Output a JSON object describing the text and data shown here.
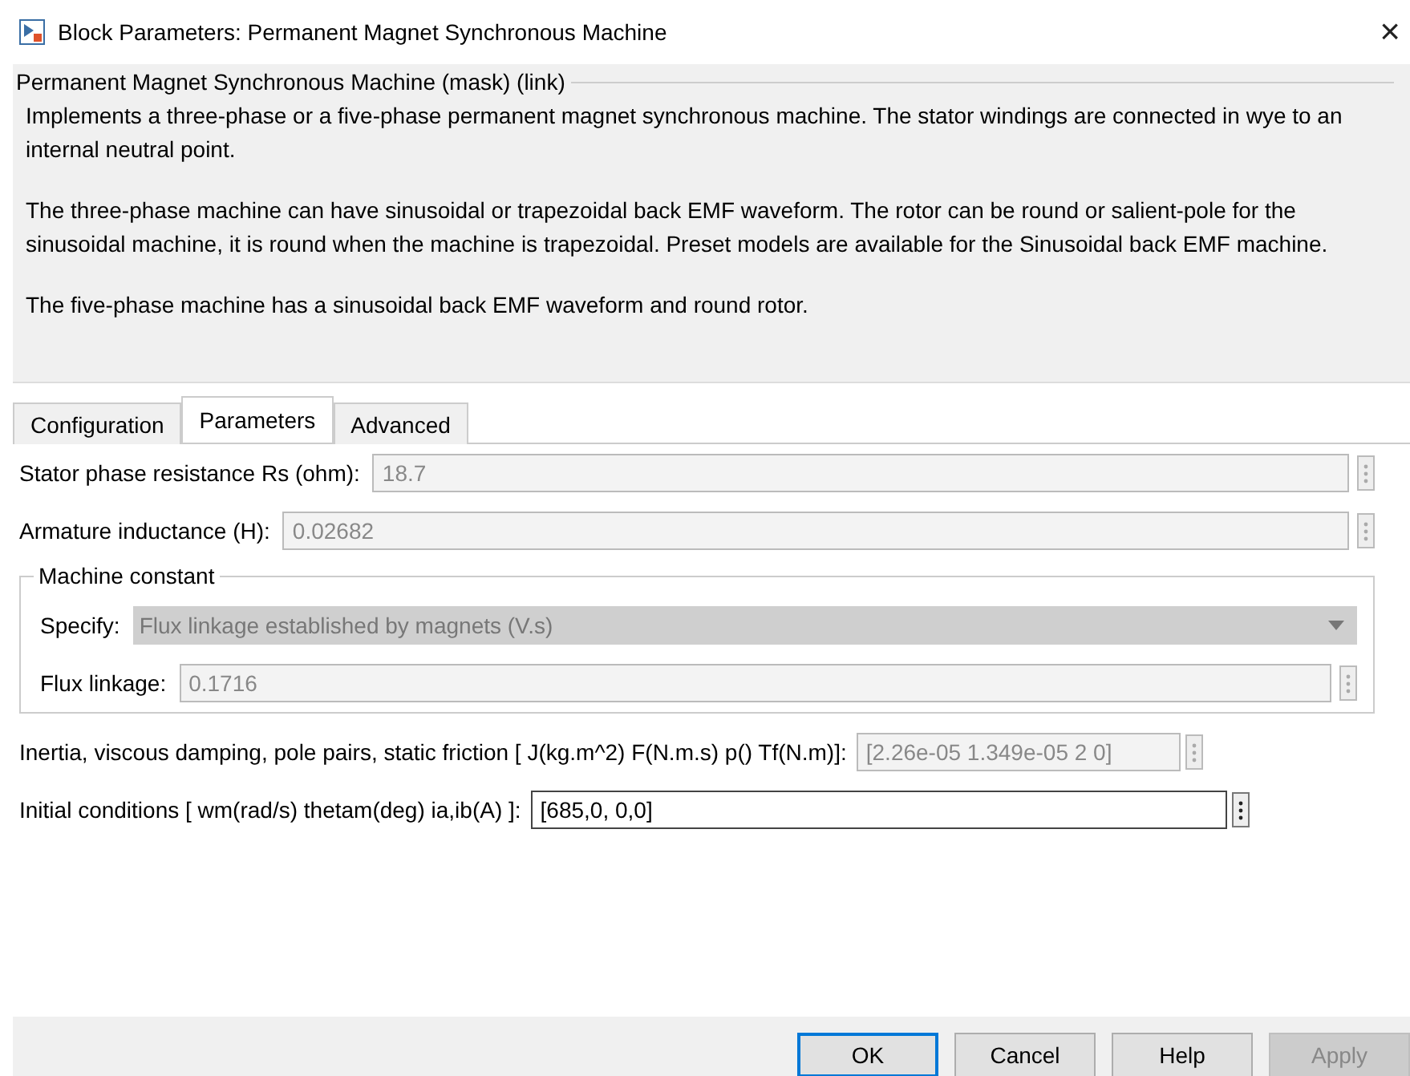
{
  "window": {
    "title": "Block Parameters: Permanent Magnet Synchronous Machine",
    "close": "×"
  },
  "description": {
    "title": "Permanent Magnet Synchronous Machine (mask) (link)",
    "paragraphs": [
      "Implements a three-phase or a five-phase permanent magnet synchronous machine. The stator windings are connected in wye to an internal neutral point.",
      "The three-phase machine can have sinusoidal or trapezoidal back EMF waveform. The rotor can be round or salient-pole for the sinusoidal machine, it is round when the machine is trapezoidal. Preset models are available for the Sinusoidal back EMF machine.",
      "The five-phase machine has a sinusoidal back EMF waveform and round rotor."
    ]
  },
  "tabs": [
    {
      "label": "Configuration",
      "selected": false
    },
    {
      "label": "Parameters",
      "selected": true
    },
    {
      "label": "Advanced",
      "selected": false
    }
  ],
  "parameters": [
    {
      "kind": "field",
      "label": "Stator phase resistance Rs (ohm):",
      "value": "18.7",
      "disabled": true
    },
    {
      "kind": "field",
      "label": "Armature inductance (H):",
      "value": "0.02682",
      "disabled": true
    },
    {
      "kind": "group",
      "title": "Machine constant",
      "items": [
        {
          "kind": "dropdown",
          "label": "Specify:",
          "value": "Flux linkage established by magnets (V.s)",
          "disabled": true
        },
        {
          "kind": "field",
          "label": "Flux linkage:",
          "value": "0.1716",
          "disabled": true
        }
      ]
    },
    {
      "kind": "field",
      "label": "Inertia, viscous damping, pole pairs, static friction [ J(kg.m^2)  F(N.m.s)  p()  Tf(N.m)]:",
      "value": "[2.26e-05 1.349e-05 2 0]",
      "disabled": true
    },
    {
      "kind": "field",
      "label": "Initial conditions  [ wm(rad/s)  thetam(deg)  ia,ib(A) ]:",
      "value": "[685,0, 0,0]",
      "disabled": false
    }
  ],
  "buttons": [
    {
      "label": "OK",
      "disabled": false,
      "default": true
    },
    {
      "label": "Cancel",
      "disabled": false,
      "default": false
    },
    {
      "label": "Help",
      "disabled": false,
      "default": false
    },
    {
      "label": "Apply",
      "disabled": true,
      "default": false
    }
  ]
}
